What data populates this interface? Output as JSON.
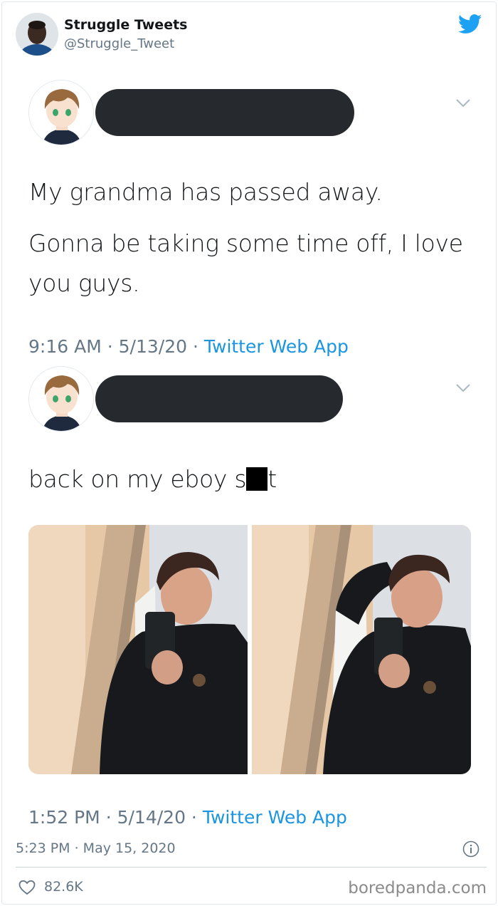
{
  "embed": {
    "name": "Struggle Tweets",
    "handle": "@Struggle_Tweet",
    "brand_color": "#1da1f2",
    "icon": "twitter-bird-icon"
  },
  "tweets": [
    {
      "paragraphs": [
        "My grandma has passed away.",
        "Gonna be taking some time off, I love you guys."
      ],
      "time": "9:16 AM",
      "date": "5/13/20",
      "source": "Twitter Web App",
      "separator": "·"
    },
    {
      "text_before": "back on my eboy s",
      "text_after": "t",
      "time": "1:52 PM",
      "date": "5/14/20",
      "source": "Twitter Web App",
      "separator": "·",
      "media_count": 2
    }
  ],
  "footer": {
    "posted": "5:23 PM · May 15, 2020",
    "likes": "82.6K",
    "watermark": "boredpanda.com"
  },
  "colors": {
    "text": "#14171a",
    "muted": "#657786",
    "link": "#1b95e0",
    "redaction": "#262a2e"
  }
}
